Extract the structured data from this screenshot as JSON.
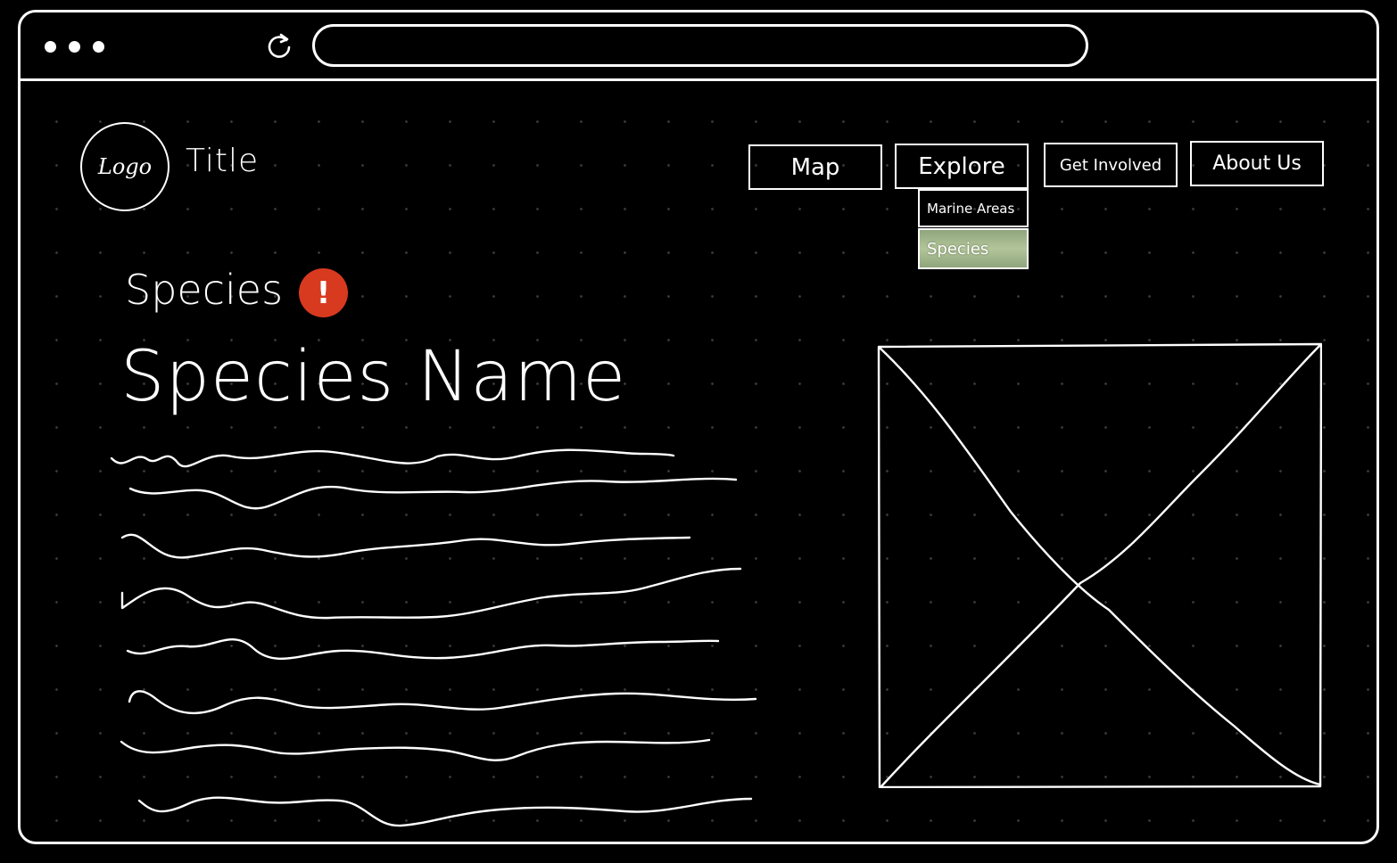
{
  "browser": {
    "address_placeholder": ""
  },
  "header": {
    "logo_text": "Logo",
    "title": "Title"
  },
  "nav": {
    "map": "Map",
    "explore": "Explore",
    "get_involved": "Get Involved",
    "about_us": "About Us",
    "explore_dropdown": {
      "marine_areas": "Marine Areas",
      "species": "Species"
    }
  },
  "main": {
    "section_label": "Species",
    "alert_symbol": "!",
    "species_name": "Species Name"
  },
  "colors": {
    "background": "#000000",
    "stroke": "#ffffff",
    "alert": "#d83a1f",
    "dropdown_active": "#a6b98e"
  },
  "icons": {
    "reload": "reload-icon",
    "alert": "alert-icon",
    "image_placeholder": "image-placeholder-icon"
  }
}
